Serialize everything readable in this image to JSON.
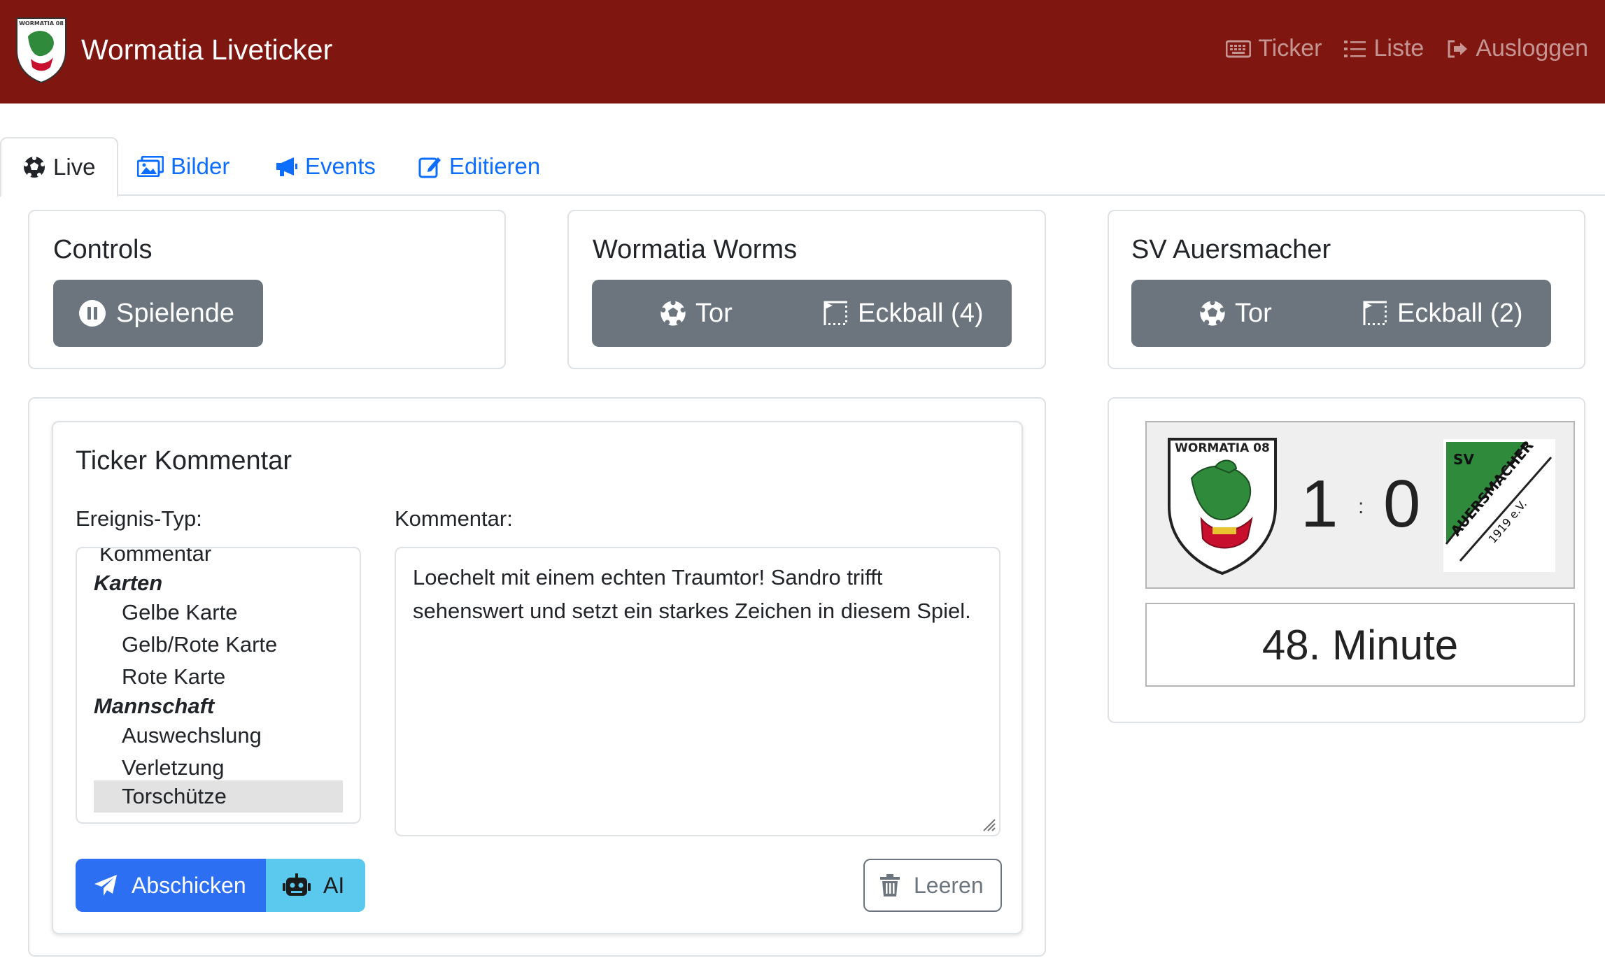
{
  "navbar": {
    "title": "Wormatia Liveticker",
    "logo_text": "WORMATIA 08",
    "links": [
      {
        "label": "Ticker",
        "icon": "keyboard-icon"
      },
      {
        "label": "Liste",
        "icon": "list-icon"
      },
      {
        "label": "Ausloggen",
        "icon": "logout-icon"
      }
    ]
  },
  "tabs": [
    {
      "label": "Live",
      "icon": "soccer-ball-icon",
      "active": true
    },
    {
      "label": "Bilder",
      "icon": "images-icon",
      "active": false
    },
    {
      "label": "Events",
      "icon": "megaphone-icon",
      "active": false
    },
    {
      "label": "Editieren",
      "icon": "edit-icon",
      "active": false
    }
  ],
  "controls": {
    "title": "Controls",
    "end_button": "Spielende"
  },
  "home_team": {
    "name": "Wormatia Worms",
    "goal_label": "Tor",
    "corner_label": "Eckball (4)"
  },
  "away_team": {
    "name": "SV Auersmacher",
    "goal_label": "Tor",
    "corner_label": "Eckball (2)"
  },
  "ticker": {
    "title": "Ticker Kommentar",
    "event_type_label": "Ereignis-Typ:",
    "comment_label": "Kommentar:",
    "event_options": [
      {
        "label": "Kommentar",
        "type": "option"
      },
      {
        "label": "Karten",
        "type": "group"
      },
      {
        "label": "Gelbe Karte",
        "type": "option"
      },
      {
        "label": "Gelb/Rote Karte",
        "type": "option"
      },
      {
        "label": "Rote Karte",
        "type": "option"
      },
      {
        "label": "Mannschaft",
        "type": "group"
      },
      {
        "label": "Auswechslung",
        "type": "option"
      },
      {
        "label": "Verletzung",
        "type": "option"
      },
      {
        "label": "Torschütze",
        "type": "option",
        "selected": true
      }
    ],
    "comment_value": "Loechelt mit einem echten Traumtor! Sandro trifft sehenswert und setzt ein starkes Zeichen in diesem Spiel.",
    "submit_label": "Abschicken",
    "ai_label": "AI",
    "clear_label": "Leeren"
  },
  "scoreboard": {
    "home_logo_text": "WORMATIA 08",
    "home_score": "1",
    "separator": ":",
    "away_score": "0",
    "away_logo_text_top": "SV",
    "away_logo_text_main": "AUERSMACHER",
    "away_logo_text_sub": "1919 e.V.",
    "minute": "48. Minute"
  },
  "colors": {
    "navbar": "#7f1610",
    "primary": "#2d6ff3",
    "info": "#5bc8ee",
    "secondary": "#6c757d",
    "link": "#0d6efd"
  }
}
